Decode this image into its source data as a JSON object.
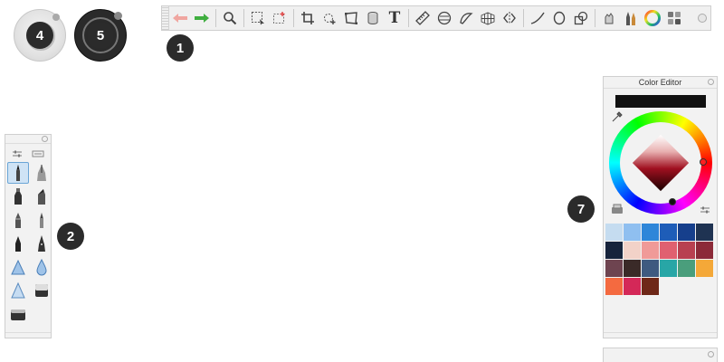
{
  "badges": {
    "b1": "1",
    "b2": "2",
    "b4": "4",
    "b5": "5",
    "b7": "7"
  },
  "toolbar": {
    "undo_icon": "undo-arrow-icon",
    "redo_icon": "redo-arrow-icon",
    "text_tool": "T"
  },
  "color_editor": {
    "title": "Color Editor",
    "current_color": "#111111",
    "swatches": [
      "#c5dcf0",
      "#8fbff0",
      "#2e86d9",
      "#1e5db8",
      "#163f8c",
      "#1f3352",
      "#16233b",
      "#f2d2c8",
      "#f09a98",
      "#e06070",
      "#b84050",
      "#8c2a38",
      "#6e4450",
      "#3a2a28",
      "#3e5a80",
      "#28a6a6",
      "#4a9e7c",
      "#f4a838",
      "#f46a40",
      "#d42858",
      "#6e2818"
    ]
  },
  "colors": {
    "panel_bg": "#f2f2f2",
    "border": "#cfcfcf",
    "redo_green": "#3fae3f",
    "undo_pink": "#f0a6a0",
    "badge_bg": "#2b2b2b"
  }
}
